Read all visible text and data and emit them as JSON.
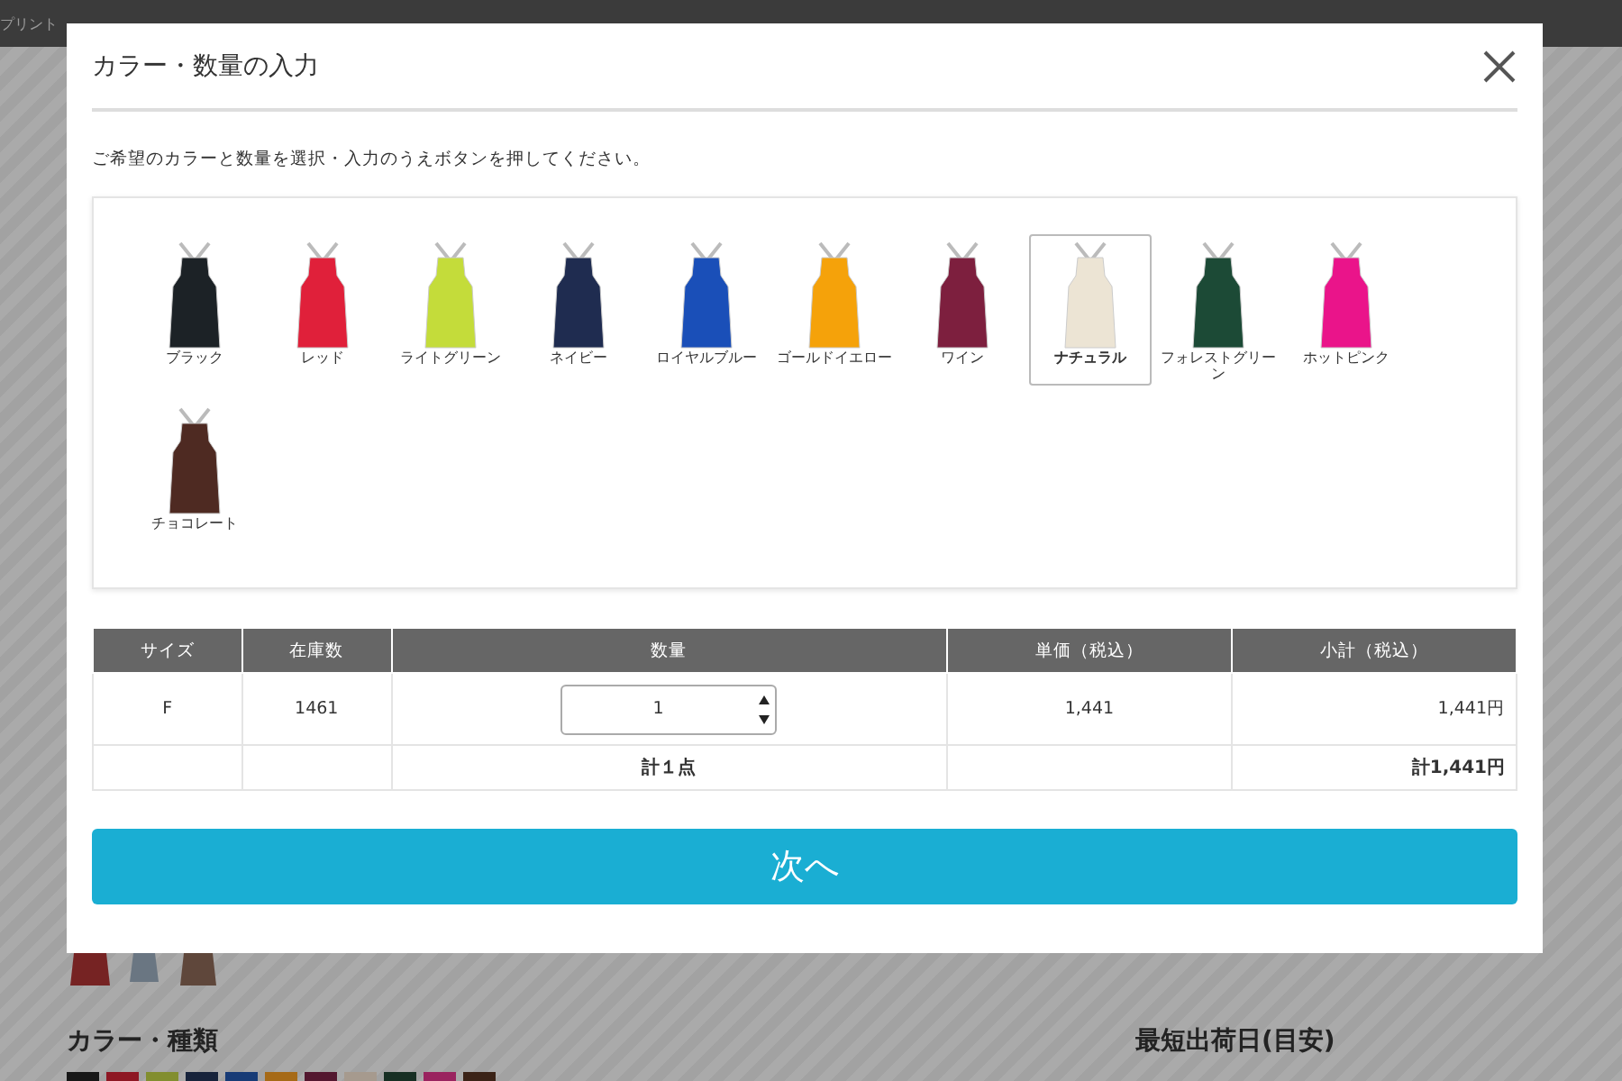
{
  "background": {
    "top_bar_text": "プリント",
    "section_title": "カラー・種類",
    "side_title": "最短出荷日(目安)"
  },
  "dialog": {
    "title": "カラー・数量の入力",
    "instruction": "ご希望のカラーと数量を選択・入力のうえボタンを押してください。",
    "colors": [
      {
        "label": "ブラック",
        "color": "#1c2226",
        "selected": false
      },
      {
        "label": "レッド",
        "color": "#e0203a",
        "selected": false
      },
      {
        "label": "ライトグリーン",
        "color": "#c4dc3a",
        "selected": false
      },
      {
        "label": "ネイビー",
        "color": "#1f2c50",
        "selected": false
      },
      {
        "label": "ロイヤルブルー",
        "color": "#1a4fb8",
        "selected": false
      },
      {
        "label": "ゴールドイエロー",
        "color": "#f5a20a",
        "selected": false
      },
      {
        "label": "ワイン",
        "color": "#7d1f3e",
        "selected": false
      },
      {
        "label": "ナチュラル",
        "color": "#ece4d4",
        "selected": true
      },
      {
        "label": "フォレストグリーン",
        "color": "#1c4a36",
        "selected": false
      },
      {
        "label": "ホットピンク",
        "color": "#ea148a",
        "selected": false
      },
      {
        "label": "チョコレート",
        "color": "#4e2a22",
        "selected": false
      }
    ],
    "table": {
      "columns": [
        "サイズ",
        "在庫数",
        "数量",
        "単価（税込）",
        "小計（税込）"
      ],
      "row": {
        "size": "F",
        "stock": "1461",
        "quantity": "1",
        "unit_price": "1,441",
        "subtotal": "1,441円"
      },
      "total": {
        "count": "計１点",
        "amount": "計1,441円"
      }
    },
    "next_button": "次へ"
  }
}
